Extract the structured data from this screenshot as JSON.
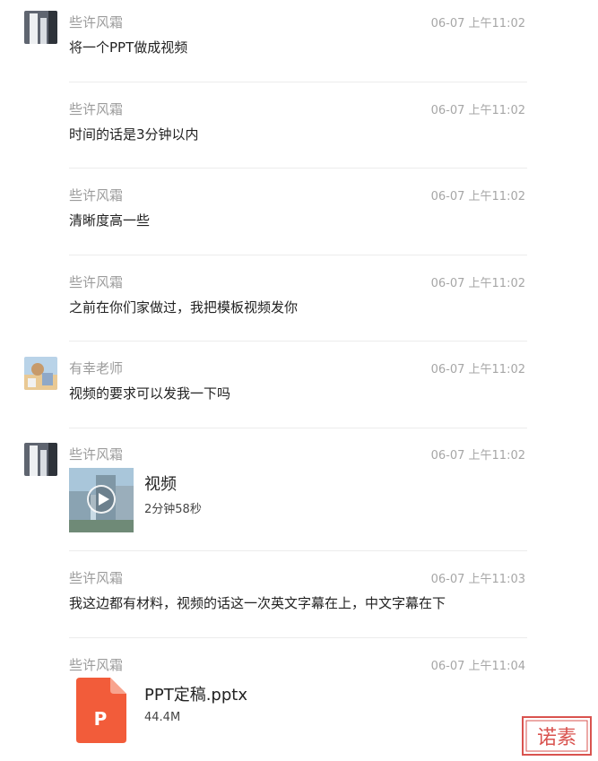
{
  "messages": [
    {
      "sender": "些许风霜",
      "time": "06-07 上午11:02",
      "text": "将一个PPT做成视频"
    },
    {
      "sender": "些许风霜",
      "time": "06-07 上午11:02",
      "text": "时间的话是3分钟以内"
    },
    {
      "sender": "些许风霜",
      "time": "06-07 上午11:02",
      "text": "清晰度高一些"
    },
    {
      "sender": "些许风霜",
      "time": "06-07 上午11:02",
      "text": "之前在你们家做过，我把模板视频发你"
    },
    {
      "sender": "有幸老师",
      "time": "06-07 上午11:02",
      "text": "视频的要求可以发我一下吗"
    },
    {
      "sender": "些许风霜",
      "time": "06-07 上午11:02",
      "video_title": "视频",
      "video_duration": "2分钟58秒"
    },
    {
      "sender": "些许风霜",
      "time": "06-07 上午11:03",
      "text": "我这边都有材料，视频的话这一次英文字幕在上，中文字幕在下"
    },
    {
      "sender": "些许风霜",
      "time": "06-07 上午11:04",
      "file_name": "PPT定稿.pptx",
      "file_size": "44.4M",
      "file_icon_letter": "P"
    }
  ],
  "colors": {
    "name": "#9b9b9b",
    "time": "#a6a6a6",
    "text": "#222222",
    "pptx": "#f25c3a",
    "stamp": "#d9534f"
  },
  "stamp_text": "诺素"
}
